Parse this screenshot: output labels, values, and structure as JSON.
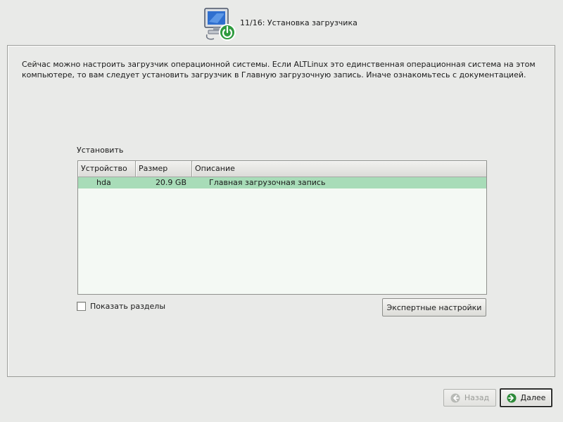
{
  "header": {
    "step_title": "11/16: Установка загрузчика",
    "icon": "computer-power-icon"
  },
  "intro_text": "Сейчас можно настроить загрузчик операционной системы. Если ALTLinux это единственная операционная система на этом компьютере, то вам следует установить загрузчик в Главную загрузочную запись. Иначе ознакомьтесь с документацией.",
  "install_label": "Установить",
  "table": {
    "columns": [
      "Устройство",
      "Размер",
      "Описание"
    ],
    "rows": [
      {
        "device": "hda",
        "size": "20.9 GB",
        "description": "Главная загрузочная запись"
      }
    ]
  },
  "show_partitions": {
    "label": "Показать разделы",
    "checked": false
  },
  "buttons": {
    "expert": "Экспертные настройки",
    "back": "Назад",
    "next": "Далее"
  },
  "icons": {
    "back": "back-arrow-icon",
    "next": "next-arrow-icon"
  },
  "colors": {
    "selected_row": "#a8dcb8",
    "next_icon": "#2e8b3a"
  }
}
